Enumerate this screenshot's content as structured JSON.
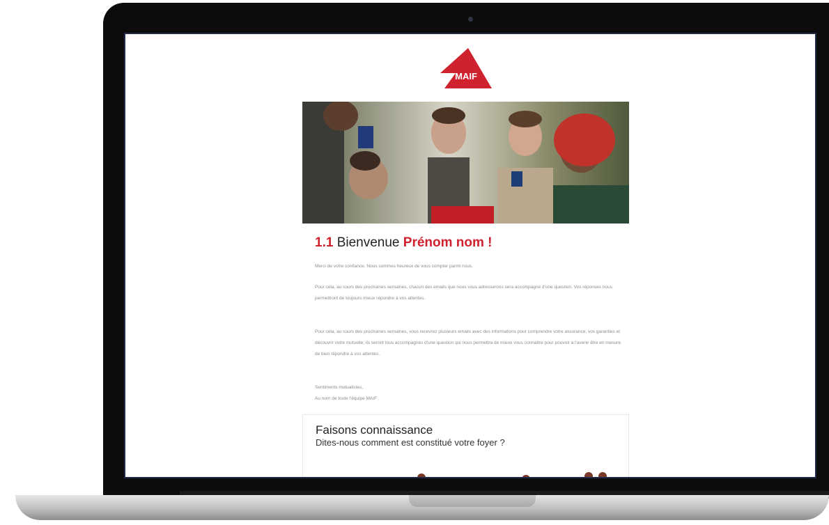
{
  "email": {
    "brand": {
      "logo_text": "MAIF",
      "color": "#d0222e"
    },
    "heading": {
      "number": "1.1",
      "word": "Bienvenue",
      "name": "Prénom nom !"
    },
    "paragraphs": [
      "Merci de votre confiance. Nous sommes heureux de vous compter parmi nous.",
      "Pour cela, au cours des prochaines semaines, chacun des emails que nous vous adresserons sera accompagné d'une question. Vos réponses nous permettront de toujours mieux répondre à vos attentes.",
      "Pour cela, au cours des prochaines semaines, vous recevrez plusieurs emails avec des informations pour comprendre votre assurance, vos garanties et découvrir votre mutuelle; ils seront tous accompagnés d'une question qui nous permettra de mieux vous connaître pour pouvoir à l'avenir être en mesure de bien répondre à vos attentes.",
      "Sentiments mutualistes,\nAu nom de toute l'équipe MAIF"
    ],
    "card": {
      "title": "Faisons connaissance",
      "subtitle": "Dites-nous comment est constitué votre foyer ?"
    }
  }
}
